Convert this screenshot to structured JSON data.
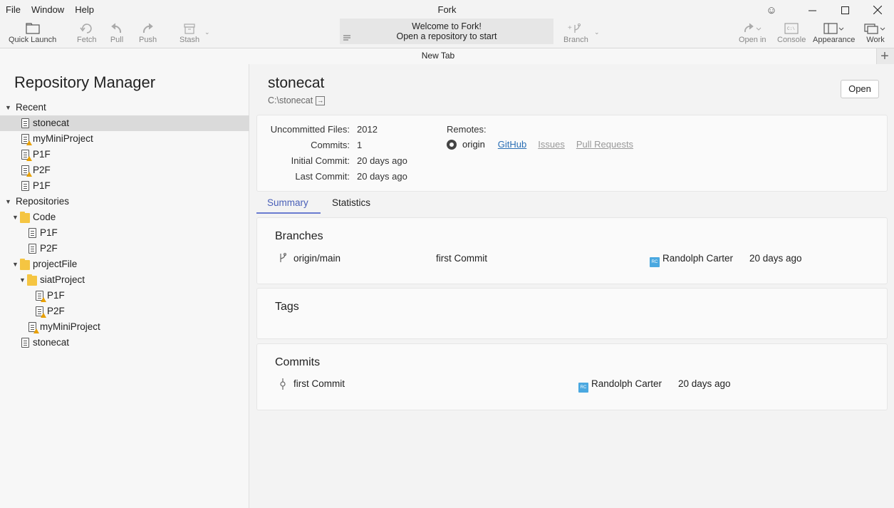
{
  "window": {
    "title": "Fork",
    "menu": [
      "File",
      "Window",
      "Help"
    ]
  },
  "toolbar": {
    "quick_launch": "Quick Launch",
    "fetch": "Fetch",
    "pull": "Pull",
    "push": "Push",
    "stash": "Stash",
    "welcome_line1": "Welcome to Fork!",
    "welcome_line2": "Open a repository to start",
    "branch": "Branch",
    "open_in": "Open in",
    "console": "Console",
    "appearance": "Appearance",
    "work": "Work"
  },
  "tabs": {
    "new_tab": "New Tab"
  },
  "sidebar": {
    "title": "Repository Manager",
    "recent_label": "Recent",
    "recent": [
      "stonecat",
      "myMiniProject",
      "P1F",
      "P2F",
      "P1F"
    ],
    "repositories_label": "Repositories",
    "code_folder": "Code",
    "code_items": [
      "P1F",
      "P2F"
    ],
    "projectfile_folder": "projectFile",
    "siat_folder": "siatProject",
    "siat_items": [
      "P1F",
      "P2F"
    ],
    "projectfile_items": [
      "myMiniProject"
    ],
    "root_items": [
      "stonecat"
    ]
  },
  "repo": {
    "name": "stonecat",
    "path": "C:\\stonecat",
    "open_button": "Open",
    "uncommitted_label": "Uncommitted Files:",
    "uncommitted": "2012",
    "commits_label": "Commits:",
    "commits": "1",
    "initial_label": "Initial Commit:",
    "initial": "20 days ago",
    "last_label": "Last Commit:",
    "last": "20 days ago",
    "remotes_label": "Remotes:",
    "remote_name": "origin",
    "link_github": "GitHub",
    "link_issues": "Issues",
    "link_prs": "Pull Requests"
  },
  "subtabs": {
    "summary": "Summary",
    "statistics": "Statistics"
  },
  "branches": {
    "title": "Branches",
    "name": "origin/main",
    "message": "first Commit",
    "author_initials": "RC",
    "author": "Randolph Carter",
    "time": "20 days ago"
  },
  "tags": {
    "title": "Tags"
  },
  "commits": {
    "title": "Commits",
    "message": "first Commit",
    "author_initials": "RC",
    "author": "Randolph Carter",
    "time": "20 days ago"
  }
}
